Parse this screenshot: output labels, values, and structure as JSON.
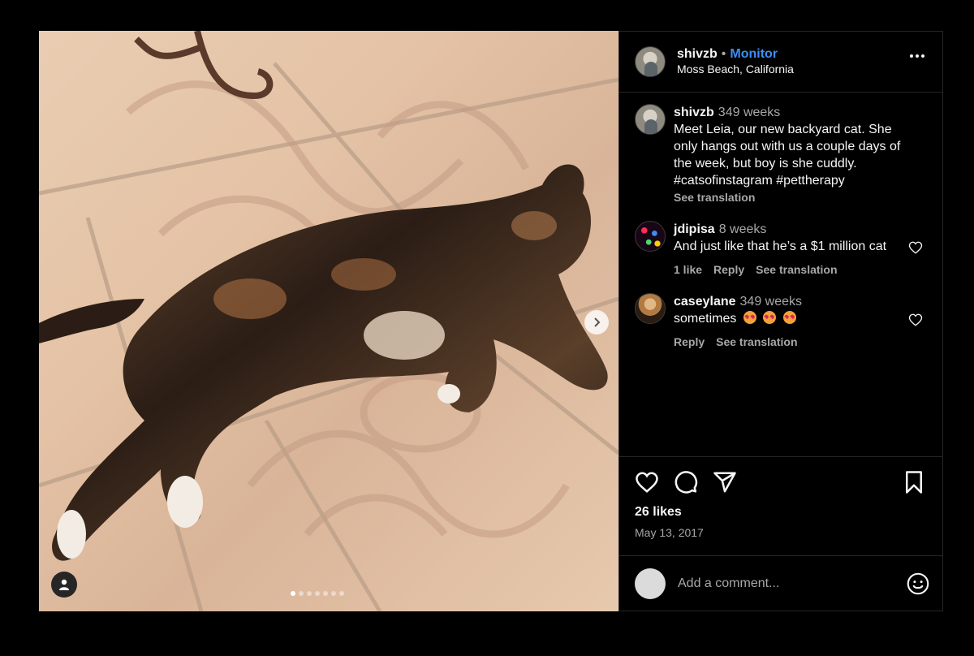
{
  "post": {
    "username": "shivzb",
    "separator": "•",
    "follow_label": "Monitor",
    "location": "Moss Beach, California"
  },
  "caption": {
    "username": "shivzb",
    "time": "349 weeks",
    "text": "Meet Leia, our new backyard cat. She only hangs out with us a couple days of the week, but boy is she cuddly. #catsofinstagram #pettherapy",
    "see_translation": "See translation"
  },
  "comments": [
    {
      "username": "jdipisa",
      "time": "8 weeks",
      "text": "And just like that he’s a $1 million cat",
      "likes_label": "1 like",
      "reply_label": "Reply",
      "translation_label": "See translation"
    },
    {
      "username": "caseylane",
      "time": "349 weeks",
      "text": "sometimes",
      "emojis": [
        "heart-eyes-cat",
        "heart-eyes-cat",
        "heart-eyes-cat"
      ],
      "reply_label": "Reply",
      "translation_label": "See translation"
    }
  ],
  "actions": {
    "likes_text": "26 likes",
    "date_text": "May 13, 2017"
  },
  "composer": {
    "placeholder": "Add a comment..."
  },
  "carousel": {
    "total_slides": 7,
    "active_index": 0
  },
  "colors": {
    "background": "#000000",
    "accent_blue": "#3b8ff5",
    "secondary_text": "#a8a8a8",
    "divider": "#262626"
  }
}
